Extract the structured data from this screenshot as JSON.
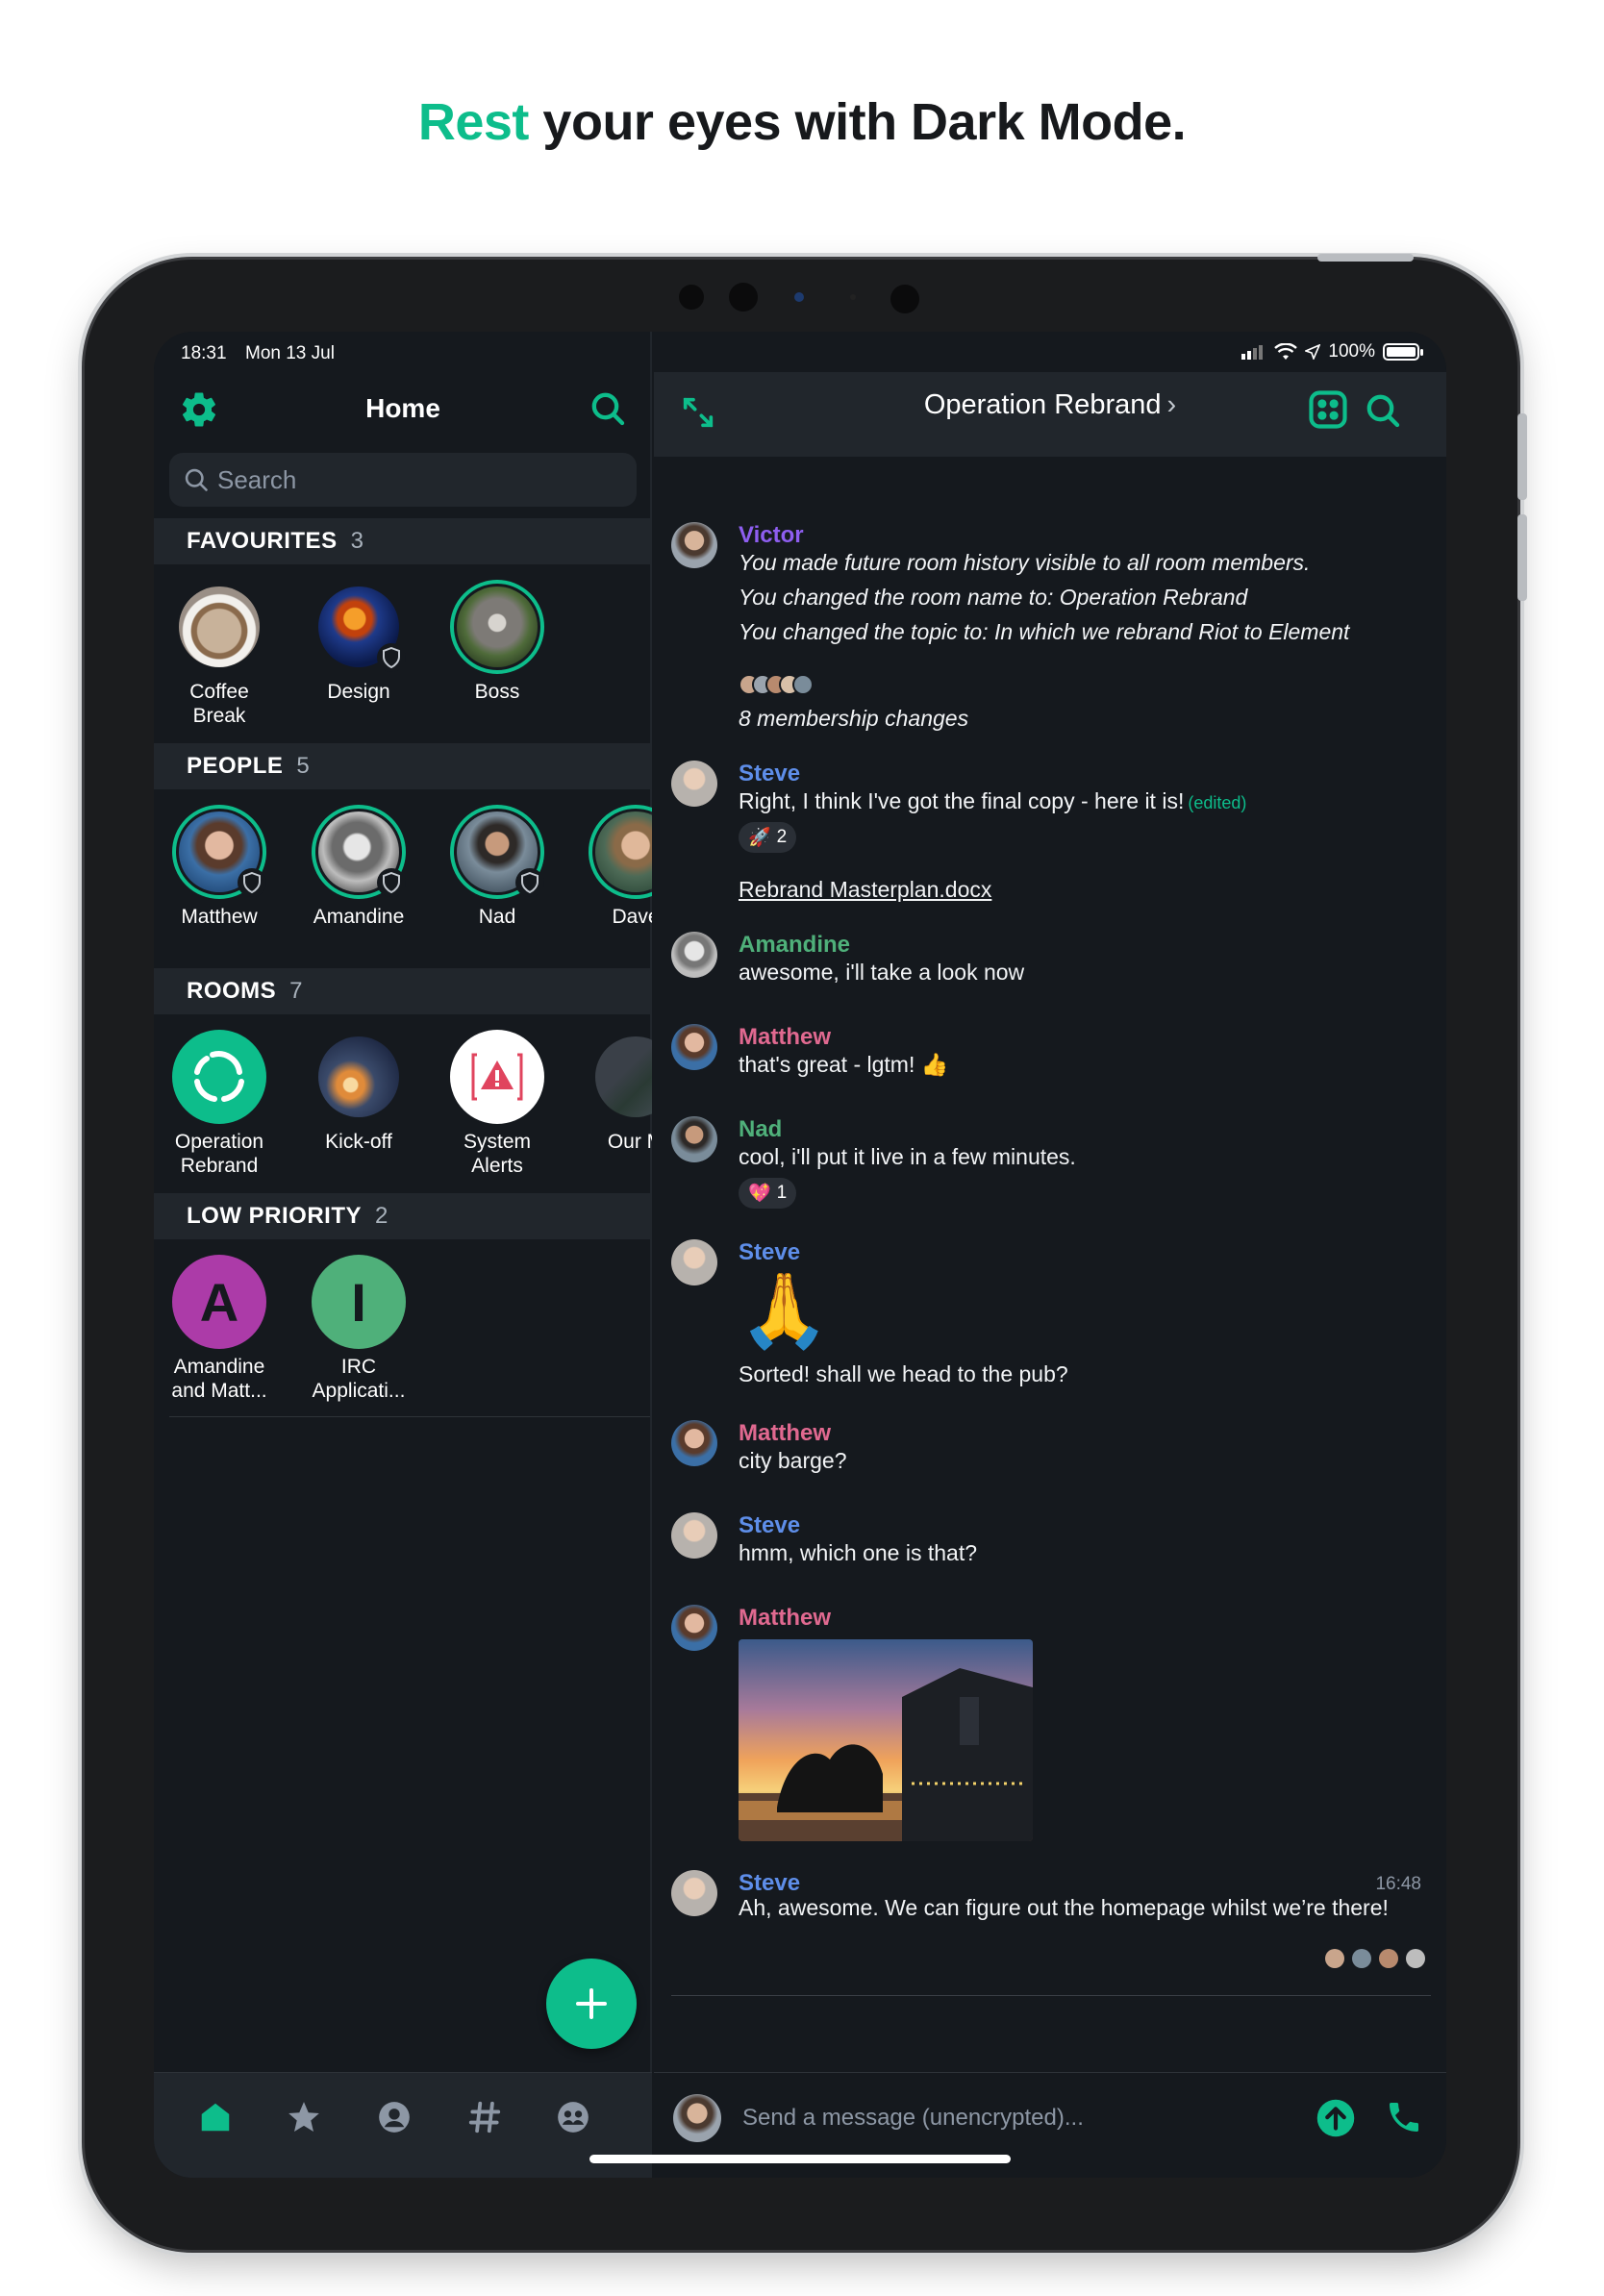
{
  "headline": {
    "accent": "Rest",
    "rest": " your eyes with Dark Mode."
  },
  "colors": {
    "accent": "#0dbd8b",
    "background": "#15191e",
    "panel": "#21262c",
    "purple": "#8e5ef0",
    "blue": "#5e8ee9",
    "green": "#4fb07a",
    "pink": "#e06990"
  },
  "status_bar": {
    "time": "18:31",
    "date": "Mon 13 Jul",
    "battery": "100%",
    "battery_level": 1.0
  },
  "sidebar": {
    "title": "Home",
    "search_placeholder": "Search",
    "sections": {
      "favourites": {
        "title": "FAVOURITES",
        "count": "3",
        "items": [
          "Coffee\nBreak",
          "Design",
          "Boss"
        ]
      },
      "people": {
        "title": "PEOPLE",
        "count": "5",
        "items": [
          "Matthew",
          "Amandine",
          "Nad",
          "Dave"
        ]
      },
      "rooms": {
        "title": "ROOMS",
        "count": "7",
        "items": [
          "Operation\nRebrand",
          "Kick-off",
          "System\nAlerts",
          "Our M"
        ]
      },
      "low_priority": {
        "title": "LOW PRIORITY",
        "count": "2",
        "items": [
          "Amandine\nand Matt...",
          "IRC\nApplicati..."
        ],
        "letters": [
          "A",
          "I"
        ]
      }
    },
    "tabs": [
      "home-icon",
      "star-icon",
      "person-icon",
      "hash-icon",
      "communities-icon"
    ]
  },
  "room": {
    "title": "Operation Rebrand",
    "messages": {
      "victor": {
        "sender": "Victor",
        "lines": [
          "You made future room history visible to all room members.",
          "You changed the room name to: Operation Rebrand",
          "You changed the topic to: In which we rebrand Riot to Element"
        ],
        "membership": "8 membership changes"
      },
      "steve1": {
        "sender": "Steve",
        "text": "Right, I think I've got the final copy - here it is!",
        "edited": "(edited)",
        "reaction_emoji": "🚀",
        "reaction_count": "2",
        "file": "Rebrand Masterplan.docx"
      },
      "amandine": {
        "sender": "Amandine",
        "text": "awesome, i'll take a look now"
      },
      "matthew1": {
        "sender": "Matthew",
        "text": "that's great - lgtm! 👍"
      },
      "nad": {
        "sender": "Nad",
        "text": "cool, i'll put it live in a few minutes.",
        "reaction_emoji": "💖",
        "reaction_count": "1"
      },
      "steve2": {
        "sender": "Steve",
        "emoji": "🙏",
        "text": "Sorted! shall we head to the pub?"
      },
      "matthew2": {
        "sender": "Matthew",
        "text": "city barge?"
      },
      "steve3": {
        "sender": "Steve",
        "text": "hmm, which one is that?"
      },
      "matthew3": {
        "sender": "Matthew"
      },
      "steve4": {
        "sender": "Steve",
        "text": "Ah, awesome. We can figure out the homepage whilst we’re there!",
        "time": "16:48"
      }
    },
    "composer_placeholder": "Send a message (unencrypted)..."
  }
}
